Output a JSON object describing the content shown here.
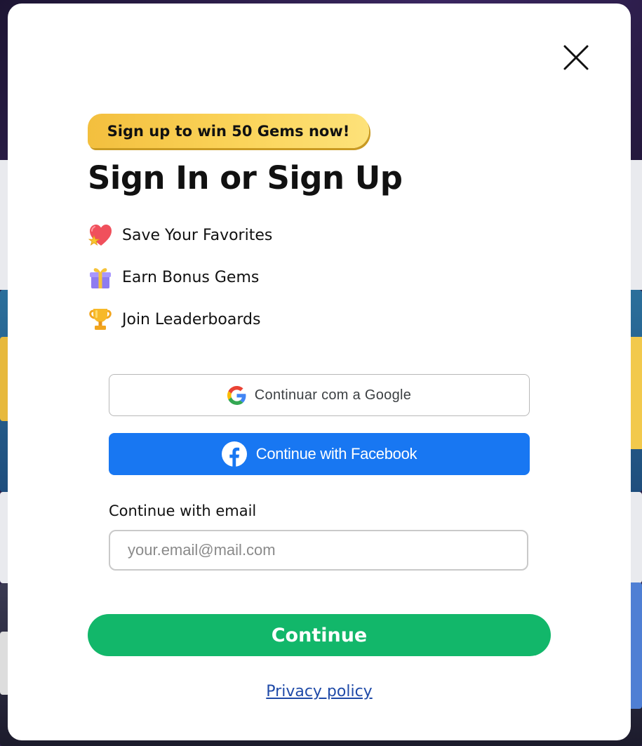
{
  "modal": {
    "promo_badge": "Sign up to win 50 Gems now!",
    "title": "Sign In or Sign Up",
    "benefits": [
      {
        "icon": "heart-star-icon",
        "label": "Save Your Favorites"
      },
      {
        "icon": "gift-icon",
        "label": "Earn Bonus Gems"
      },
      {
        "icon": "trophy-icon",
        "label": "Join Leaderboards"
      }
    ],
    "google_button": {
      "label": "Continuar com a Google",
      "icon": "google-icon"
    },
    "facebook_button": {
      "label": "Continue with Facebook",
      "icon": "facebook-icon"
    },
    "email": {
      "label": "Continue with email",
      "placeholder": "your.email@mail.com",
      "value": ""
    },
    "continue_button": "Continue",
    "privacy_link": "Privacy policy",
    "close_icon": "close-icon"
  },
  "colors": {
    "facebook": "#1877f2",
    "continue": "#12b76a",
    "promo_badge": "#fbd45a",
    "link": "#1f4aa8"
  }
}
